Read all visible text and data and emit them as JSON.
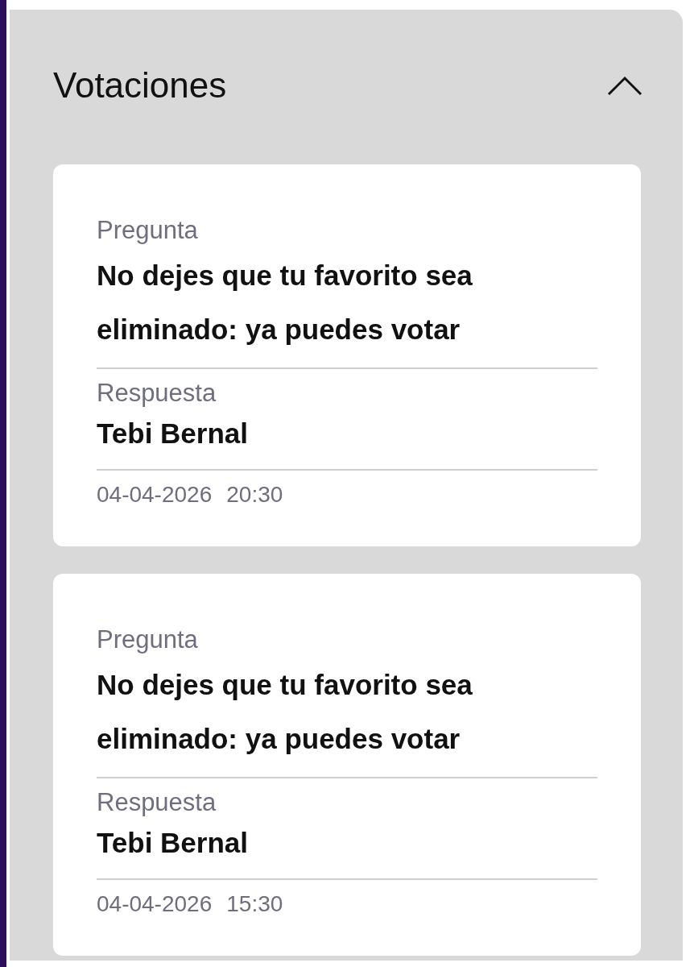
{
  "section": {
    "title": "Votaciones",
    "expanded": true
  },
  "votes": [
    {
      "question_label": "Pregunta",
      "question": "No dejes que tu favorito sea eliminado: ya puedes votar",
      "answer_label": "Respuesta",
      "answer": "Tebi Bernal",
      "date": "04-04-2026",
      "time": "20:30"
    },
    {
      "question_label": "Pregunta",
      "question": "No dejes que tu favorito sea eliminado: ya puedes votar",
      "answer_label": "Respuesta",
      "answer": "Tebi Bernal",
      "date": "04-04-2026",
      "time": "15:30"
    }
  ]
}
